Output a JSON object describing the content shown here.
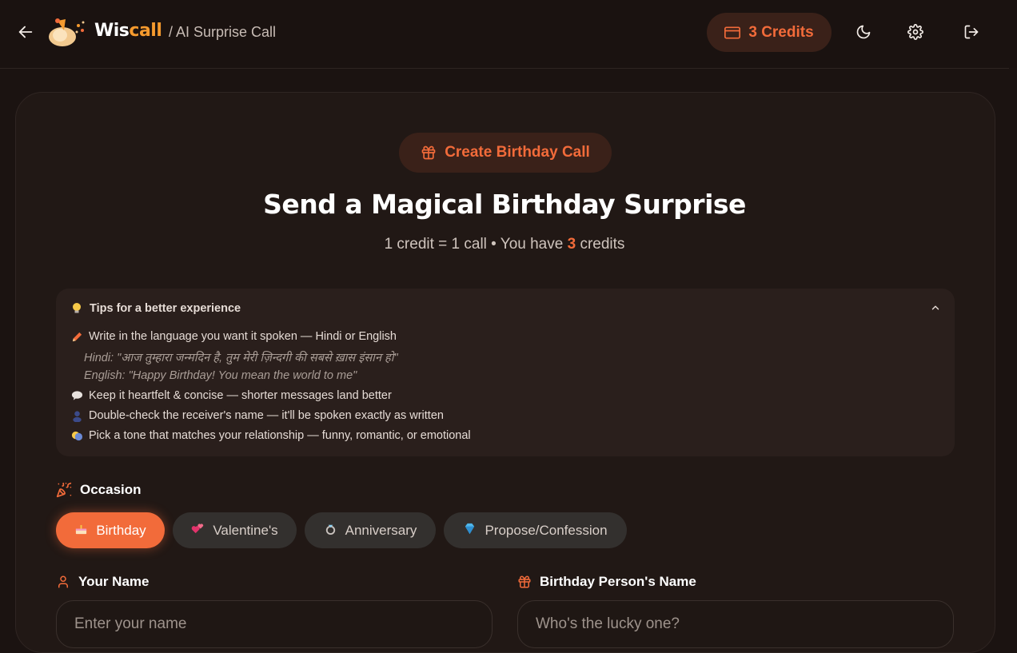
{
  "header": {
    "brand_part1": "Wis",
    "brand_part2": "call",
    "breadcrumb": "/ AI Surprise Call",
    "credits_label": "3 Credits",
    "icons": [
      "arrow-left-icon",
      "moon-icon",
      "gear-icon",
      "logout-icon"
    ]
  },
  "hero": {
    "create_button": "Create Birthday Call",
    "title": "Send a Magical Birthday Surprise",
    "sub_prefix": "1 credit = 1 call • You have ",
    "sub_count": "3",
    "sub_suffix": " credits"
  },
  "tips": {
    "heading": "Tips for a better experience",
    "items": [
      "Write in the language you want it spoken — Hindi or English",
      "Keep it heartfelt & concise — shorter messages land better",
      "Double-check the receiver's name — it'll be spoken exactly as written",
      "Pick a tone that matches your relationship — funny, romantic, or emotional"
    ],
    "example_hindi": "Hindi: \"आज तुम्हारा जन्मदिन है, तुम मेरी ज़िन्दगी की सबसे ख़ास इंसान हो\"",
    "example_english": "English: \"Happy Birthday! You mean the world to me\""
  },
  "occasion": {
    "label": "Occasion",
    "options": [
      "Birthday",
      "Valentine's",
      "Anniversary",
      "Propose/Confession"
    ],
    "selected": "Birthday"
  },
  "form": {
    "your_name_label": "Your Name",
    "your_name_placeholder": "Enter your name",
    "birthday_name_label": "Birthday Person's Name",
    "birthday_name_placeholder": "Who's the lucky one?"
  },
  "colors": {
    "accent": "#f26b3a",
    "brand_orange": "#f59a2e",
    "background": "#1b1311"
  }
}
